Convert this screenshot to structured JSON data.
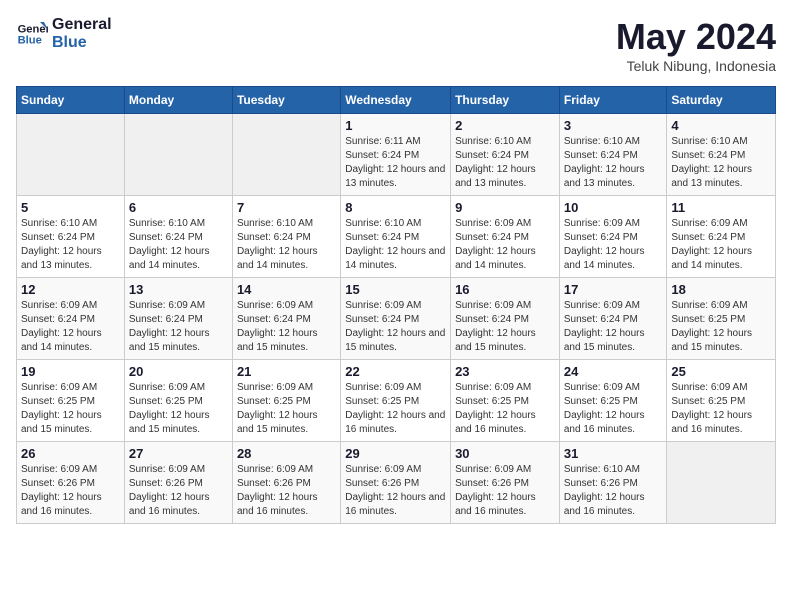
{
  "header": {
    "logo_line1": "General",
    "logo_line2": "Blue",
    "month_title": "May 2024",
    "location": "Teluk Nibung, Indonesia"
  },
  "days_of_week": [
    "Sunday",
    "Monday",
    "Tuesday",
    "Wednesday",
    "Thursday",
    "Friday",
    "Saturday"
  ],
  "weeks": [
    [
      {
        "day": "",
        "sunrise": "",
        "sunset": "",
        "daylight": ""
      },
      {
        "day": "",
        "sunrise": "",
        "sunset": "",
        "daylight": ""
      },
      {
        "day": "",
        "sunrise": "",
        "sunset": "",
        "daylight": ""
      },
      {
        "day": "1",
        "sunrise": "6:11 AM",
        "sunset": "6:24 PM",
        "daylight": "12 hours and 13 minutes."
      },
      {
        "day": "2",
        "sunrise": "6:10 AM",
        "sunset": "6:24 PM",
        "daylight": "12 hours and 13 minutes."
      },
      {
        "day": "3",
        "sunrise": "6:10 AM",
        "sunset": "6:24 PM",
        "daylight": "12 hours and 13 minutes."
      },
      {
        "day": "4",
        "sunrise": "6:10 AM",
        "sunset": "6:24 PM",
        "daylight": "12 hours and 13 minutes."
      }
    ],
    [
      {
        "day": "5",
        "sunrise": "6:10 AM",
        "sunset": "6:24 PM",
        "daylight": "12 hours and 13 minutes."
      },
      {
        "day": "6",
        "sunrise": "6:10 AM",
        "sunset": "6:24 PM",
        "daylight": "12 hours and 14 minutes."
      },
      {
        "day": "7",
        "sunrise": "6:10 AM",
        "sunset": "6:24 PM",
        "daylight": "12 hours and 14 minutes."
      },
      {
        "day": "8",
        "sunrise": "6:10 AM",
        "sunset": "6:24 PM",
        "daylight": "12 hours and 14 minutes."
      },
      {
        "day": "9",
        "sunrise": "6:09 AM",
        "sunset": "6:24 PM",
        "daylight": "12 hours and 14 minutes."
      },
      {
        "day": "10",
        "sunrise": "6:09 AM",
        "sunset": "6:24 PM",
        "daylight": "12 hours and 14 minutes."
      },
      {
        "day": "11",
        "sunrise": "6:09 AM",
        "sunset": "6:24 PM",
        "daylight": "12 hours and 14 minutes."
      }
    ],
    [
      {
        "day": "12",
        "sunrise": "6:09 AM",
        "sunset": "6:24 PM",
        "daylight": "12 hours and 14 minutes."
      },
      {
        "day": "13",
        "sunrise": "6:09 AM",
        "sunset": "6:24 PM",
        "daylight": "12 hours and 15 minutes."
      },
      {
        "day": "14",
        "sunrise": "6:09 AM",
        "sunset": "6:24 PM",
        "daylight": "12 hours and 15 minutes."
      },
      {
        "day": "15",
        "sunrise": "6:09 AM",
        "sunset": "6:24 PM",
        "daylight": "12 hours and 15 minutes."
      },
      {
        "day": "16",
        "sunrise": "6:09 AM",
        "sunset": "6:24 PM",
        "daylight": "12 hours and 15 minutes."
      },
      {
        "day": "17",
        "sunrise": "6:09 AM",
        "sunset": "6:24 PM",
        "daylight": "12 hours and 15 minutes."
      },
      {
        "day": "18",
        "sunrise": "6:09 AM",
        "sunset": "6:25 PM",
        "daylight": "12 hours and 15 minutes."
      }
    ],
    [
      {
        "day": "19",
        "sunrise": "6:09 AM",
        "sunset": "6:25 PM",
        "daylight": "12 hours and 15 minutes."
      },
      {
        "day": "20",
        "sunrise": "6:09 AM",
        "sunset": "6:25 PM",
        "daylight": "12 hours and 15 minutes."
      },
      {
        "day": "21",
        "sunrise": "6:09 AM",
        "sunset": "6:25 PM",
        "daylight": "12 hours and 15 minutes."
      },
      {
        "day": "22",
        "sunrise": "6:09 AM",
        "sunset": "6:25 PM",
        "daylight": "12 hours and 16 minutes."
      },
      {
        "day": "23",
        "sunrise": "6:09 AM",
        "sunset": "6:25 PM",
        "daylight": "12 hours and 16 minutes."
      },
      {
        "day": "24",
        "sunrise": "6:09 AM",
        "sunset": "6:25 PM",
        "daylight": "12 hours and 16 minutes."
      },
      {
        "day": "25",
        "sunrise": "6:09 AM",
        "sunset": "6:25 PM",
        "daylight": "12 hours and 16 minutes."
      }
    ],
    [
      {
        "day": "26",
        "sunrise": "6:09 AM",
        "sunset": "6:26 PM",
        "daylight": "12 hours and 16 minutes."
      },
      {
        "day": "27",
        "sunrise": "6:09 AM",
        "sunset": "6:26 PM",
        "daylight": "12 hours and 16 minutes."
      },
      {
        "day": "28",
        "sunrise": "6:09 AM",
        "sunset": "6:26 PM",
        "daylight": "12 hours and 16 minutes."
      },
      {
        "day": "29",
        "sunrise": "6:09 AM",
        "sunset": "6:26 PM",
        "daylight": "12 hours and 16 minutes."
      },
      {
        "day": "30",
        "sunrise": "6:09 AM",
        "sunset": "6:26 PM",
        "daylight": "12 hours and 16 minutes."
      },
      {
        "day": "31",
        "sunrise": "6:10 AM",
        "sunset": "6:26 PM",
        "daylight": "12 hours and 16 minutes."
      },
      {
        "day": "",
        "sunrise": "",
        "sunset": "",
        "daylight": ""
      }
    ]
  ],
  "labels": {
    "sunrise": "Sunrise:",
    "sunset": "Sunset:",
    "daylight": "Daylight:"
  }
}
